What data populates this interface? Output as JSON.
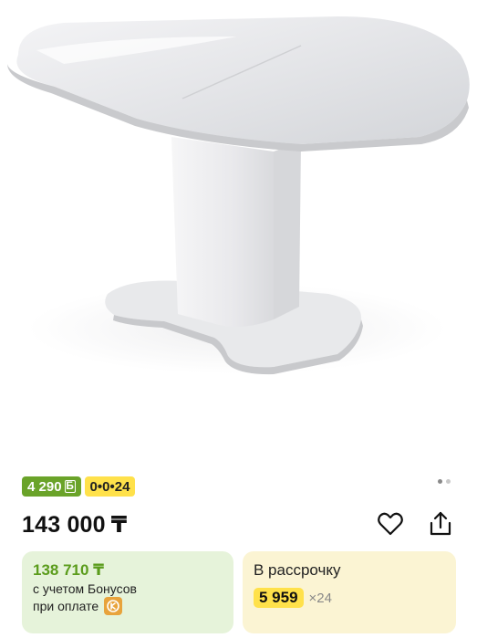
{
  "product": {
    "image_alt": "white extendable dining table"
  },
  "badges": {
    "bonus_amount": "4 290",
    "bonus_mark": "Б",
    "installment_plan": "0•0•24"
  },
  "gallery": {
    "dots_total": 2,
    "active_index": 0
  },
  "price": {
    "amount": "143 000",
    "currency": "₸"
  },
  "bonus_card": {
    "price": "138 710 ₸",
    "line1": "с учетом Бонусов",
    "line2": "при оплате"
  },
  "installment_card": {
    "title": "В рассрочку",
    "amount": "5 959",
    "months": "×24"
  },
  "icons": {
    "favorite": "heart-icon",
    "share": "share-icon",
    "bank": "kaspi-logo-icon"
  },
  "colors": {
    "bonus_green": "#6aa329",
    "installment_yellow": "#ffe14a",
    "bonus_card_bg": "#e6f3da",
    "installment_card_bg": "#fbf4d3"
  }
}
